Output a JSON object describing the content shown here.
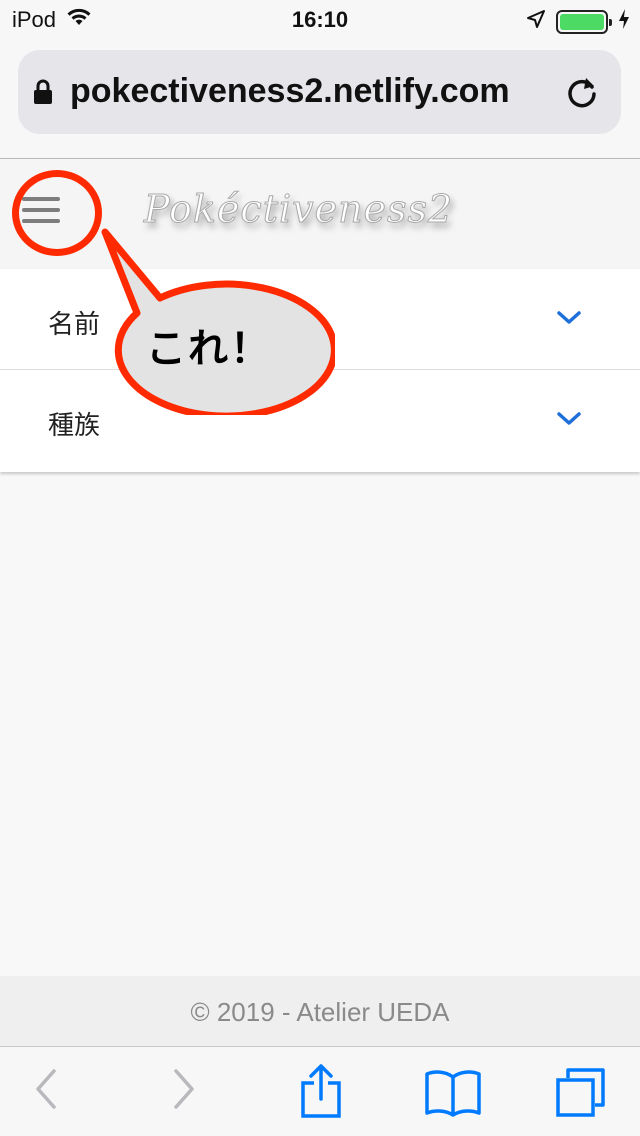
{
  "status_bar": {
    "carrier": "iPod",
    "time": "16:10",
    "icons": [
      "wifi-icon",
      "location-arrow-icon",
      "battery-icon",
      "charging-bolt-icon"
    ],
    "battery_level_percent": 100,
    "battery_color": "#4cd964"
  },
  "browser": {
    "url": "pokectiveness2.netlify.com",
    "icons": [
      "lock-icon",
      "reload-icon"
    ]
  },
  "app": {
    "logo": "Pokéctiveness2",
    "menu_icon": "hamburger-menu-icon"
  },
  "annotation": {
    "callout_text": "これ！",
    "color": "#ff2a00"
  },
  "list": {
    "rows": [
      {
        "label": "名前"
      },
      {
        "label": "種族"
      }
    ],
    "chevron_color": "#1e6fd9"
  },
  "footer": {
    "text": "© 2019 - Atelier UEDA"
  },
  "toolbar": {
    "icons": [
      "back-icon",
      "forward-icon",
      "share-icon",
      "bookmarks-icon",
      "tabs-icon"
    ],
    "accent": "#007aff"
  }
}
